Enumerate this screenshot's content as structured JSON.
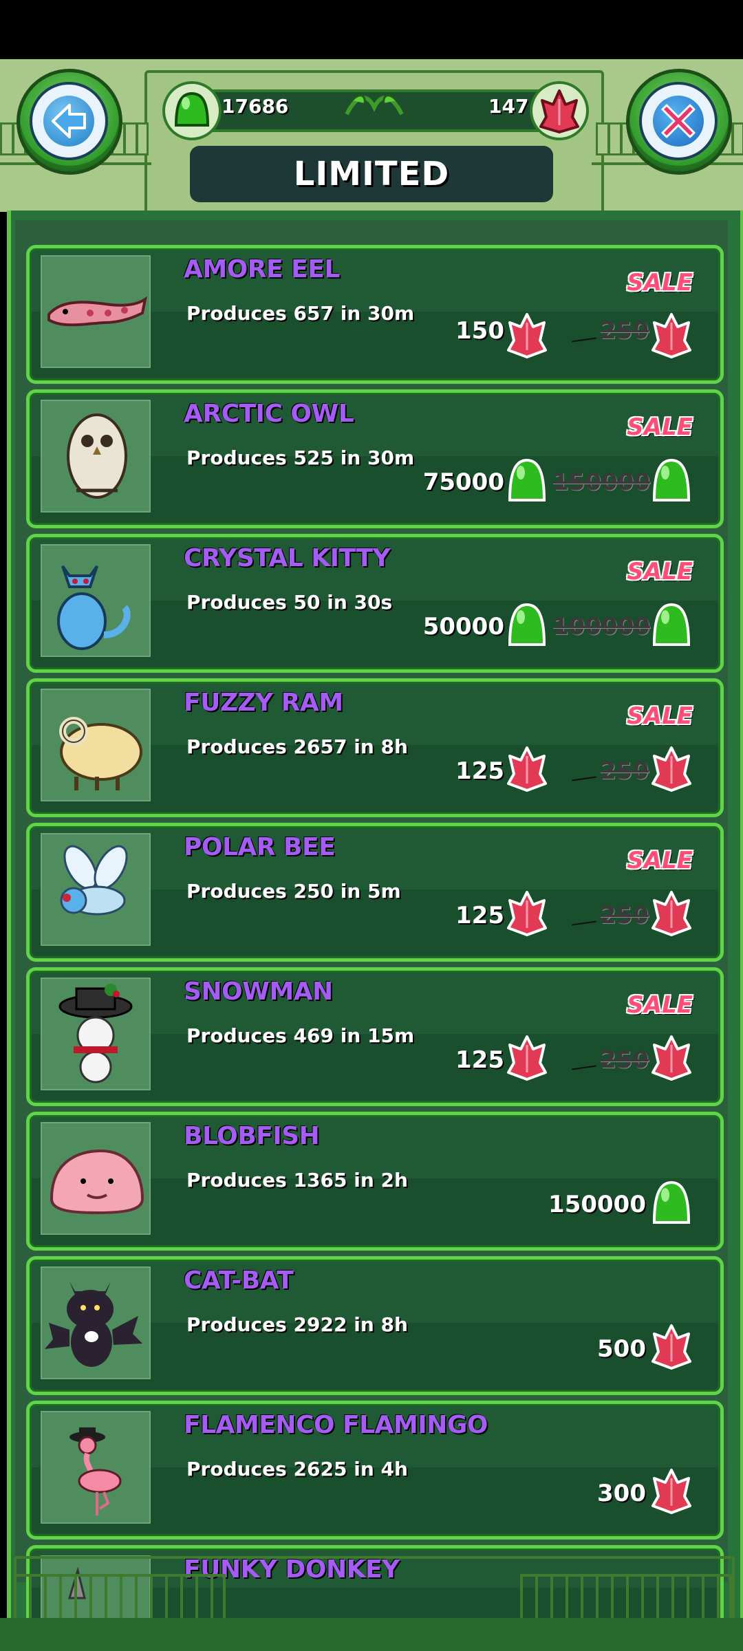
{
  "header": {
    "title": "LIMITED",
    "gems_green": "17686",
    "gems_red": "147"
  },
  "items": [
    {
      "name": "AMORE EEL",
      "produces": "Produces 657 in 30m",
      "sale": "SALE",
      "price": "150",
      "old_price": "250",
      "currency": "red-gem"
    },
    {
      "name": "ARCTIC OWL",
      "produces": "Produces 525 in 30m",
      "sale": "SALE",
      "price": "75000",
      "old_price": "150000",
      "currency": "green-gem"
    },
    {
      "name": "CRYSTAL KITTY",
      "produces": "Produces 50 in 30s",
      "sale": "SALE",
      "price": "50000",
      "old_price": "100000",
      "currency": "green-gem"
    },
    {
      "name": "FUZZY RAM",
      "produces": "Produces 2657 in 8h",
      "sale": "SALE",
      "price": "125",
      "old_price": "250",
      "currency": "red-gem"
    },
    {
      "name": "POLAR BEE",
      "produces": "Produces 250 in 5m",
      "sale": "SALE",
      "price": "125",
      "old_price": "250",
      "currency": "red-gem"
    },
    {
      "name": "SNOWMAN",
      "produces": "Produces 469 in 15m",
      "sale": "SALE",
      "price": "125",
      "old_price": "250",
      "currency": "red-gem"
    },
    {
      "name": "BLOBFISH",
      "produces": "Produces 1365 in 2h",
      "price": "150000",
      "currency": "green-gem"
    },
    {
      "name": "CAT-BAT",
      "produces": "Produces 2922 in 8h",
      "price": "500",
      "currency": "red-gem"
    },
    {
      "name": "FLAMENCO FLAMINGO",
      "produces": "Produces 2625 in 4h",
      "price": "300",
      "currency": "red-gem"
    },
    {
      "name": "FUNKY DONKEY"
    }
  ],
  "colors": {
    "accent_green": "#5fd448",
    "name_purple": "#a55cf5",
    "sale_pink": "#ff4d77"
  }
}
